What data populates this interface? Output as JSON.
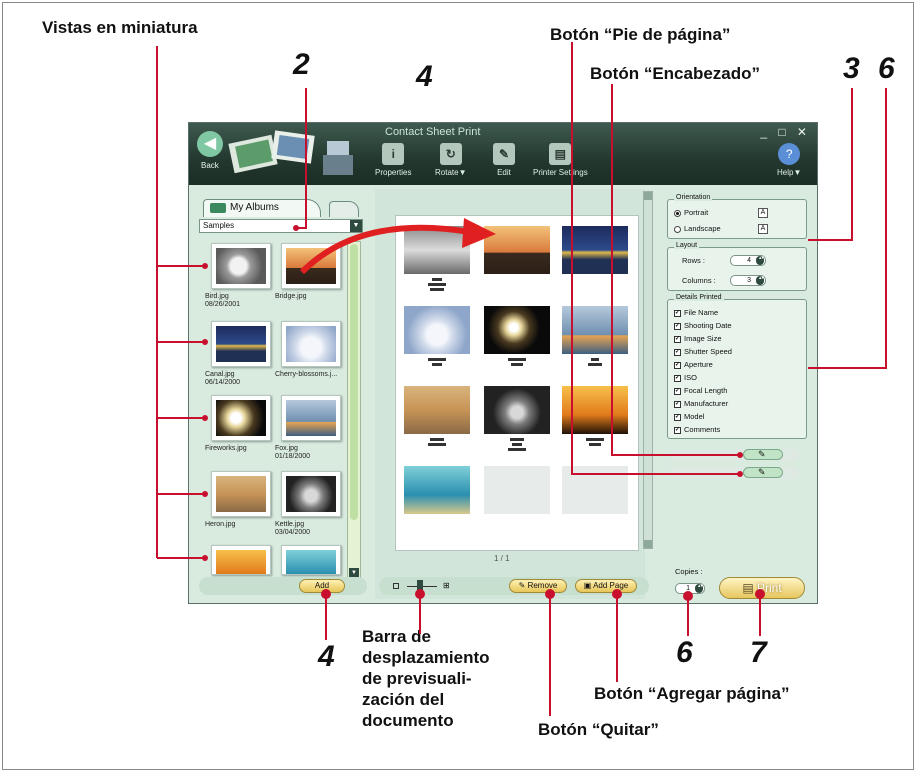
{
  "callouts": {
    "thumbnails": "Vistas en miniatura",
    "footer_button": "Botón “Pie de página”",
    "header_button": "Botón “Encabezado”",
    "scroll_bar": "Barra de desplazamiento de previsuali- zación del documento",
    "remove_button": "Botón “Quitar”",
    "add_page_button": "Botón “Agregar página”"
  },
  "numbers": {
    "n2": "2",
    "n4_top": "4",
    "n3": "3",
    "n6_top": "6",
    "n4_bottom": "4",
    "n6_bottom": "6",
    "n7": "7"
  },
  "app": {
    "title": "Contact Sheet Print",
    "back": "Back",
    "toolbar": [
      {
        "label": "Properties",
        "icon": "properties-icon"
      },
      {
        "label": "Rotate▼",
        "icon": "rotate-icon"
      },
      {
        "label": "Edit",
        "icon": "edit-icon"
      },
      {
        "label": "Printer Settings",
        "icon": "printer-icon"
      }
    ],
    "help": "Help▼",
    "tab_albums": "My Albums",
    "album_selected": "Samples",
    "thumbs": [
      {
        "name": "Bird.jpg",
        "date": "08/26/2001"
      },
      {
        "name": "Bridge.jpg",
        "date": ""
      },
      {
        "name": "Canal.jpg",
        "date": "06/14/2000"
      },
      {
        "name": "Cherry-blossoms.j...",
        "date": ""
      },
      {
        "name": "Fireworks.jpg",
        "date": ""
      },
      {
        "name": "Fox.jpg",
        "date": "01/18/2000"
      },
      {
        "name": "Heron.jpg",
        "date": ""
      },
      {
        "name": "Kettle.jpg",
        "date": "03/04/2000"
      }
    ],
    "add_label": "Add",
    "remove_label": "Remove",
    "add_page_label": "Add Page",
    "page_indicator": "1 / 1",
    "orientation": {
      "group": "Orientation",
      "portrait": "Portrait",
      "landscape": "Landscape"
    },
    "layout": {
      "group": "Layout",
      "rows_label": "Rows :",
      "rows_value": "4",
      "columns_label": "Columns :",
      "columns_value": "3"
    },
    "details": {
      "group": "Details Printed",
      "items": [
        "File Name",
        "Shooting Date",
        "Image Size",
        "Shutter Speed",
        "Aperture",
        "ISO",
        "Focal Length",
        "Manufacturer",
        "Model",
        "Comments"
      ]
    },
    "copies_label": "Copies :",
    "copies_value": "1",
    "print_label": "Print"
  }
}
